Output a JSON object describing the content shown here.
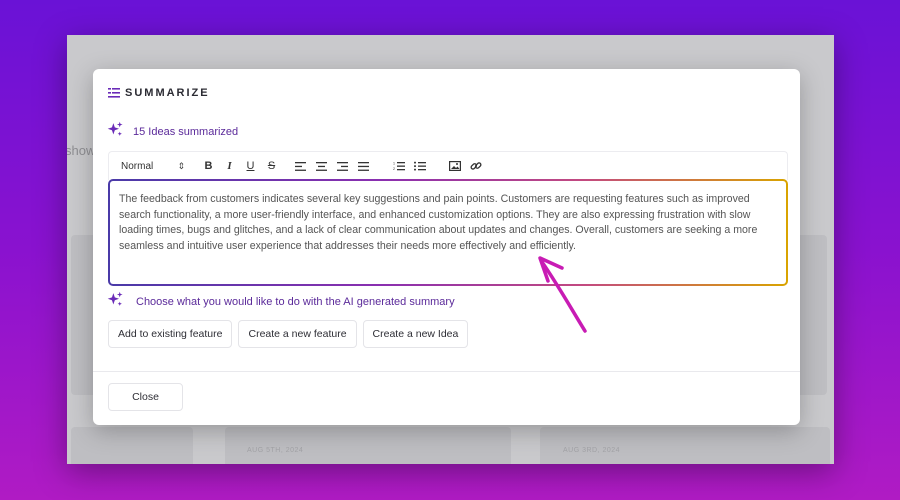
{
  "background": {
    "gradient_top": "#6a12d6",
    "gradient_bottom": "#b01bc4"
  },
  "app": {
    "bg_text": "show",
    "dates": [
      "AUG 5TH, 2024",
      "AUG 3RD, 2024"
    ]
  },
  "modal": {
    "title": "SUMMARIZE",
    "ideas_summarized": "15 Ideas summarized",
    "toolbar": {
      "format_select": "Normal",
      "bold": "B",
      "italic": "I",
      "underline": "U",
      "strike": "S"
    },
    "summary_text": "The feedback from customers indicates several key suggestions and pain points. Customers are requesting features such as improved search functionality, a more user-friendly interface, and enhanced customization options. They are also expressing frustration with slow loading times, bugs and glitches, and a lack of clear communication about updates and changes. Overall, customers are seeking a more seamless and intuitive user experience that addresses their needs more effectively and efficiently.",
    "choose_prompt": "Choose what you would like to do with the AI generated summary",
    "actions": {
      "add_existing": "Add to existing feature",
      "new_feature": "Create a new feature",
      "new_idea": "Create a new Idea"
    },
    "close_label": "Close"
  },
  "colors": {
    "accent_purple": "#5b2a9a",
    "sparkle": "#6a2bb8",
    "annotation_arrow": "#c81cb4"
  },
  "icons": {
    "header": "list-icon",
    "sparkle": "sparkle-icon",
    "annotation": "arrow-annotation"
  }
}
